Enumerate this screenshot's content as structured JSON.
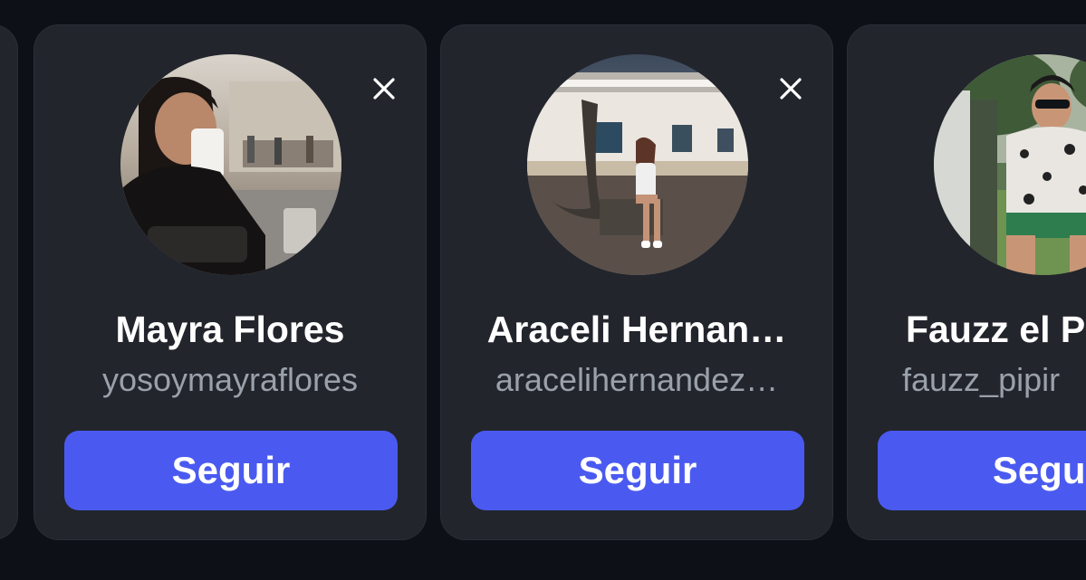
{
  "suggestions": [
    {
      "name": "Mayra Flores",
      "username": "yosoymayraflores",
      "follow_label": "Seguir",
      "avatar_icon": "profile-photo"
    },
    {
      "name": "Araceli Hernan…",
      "username": "aracelihernandez…",
      "follow_label": "Seguir",
      "avatar_icon": "profile-photo"
    },
    {
      "name": "Fauzz el P",
      "username": "fauzz_pipir",
      "follow_label": "Segui",
      "avatar_icon": "profile-photo"
    }
  ],
  "icons": {
    "close": "close-icon"
  },
  "colors": {
    "background": "#0d1117",
    "card": "#22252c",
    "button": "#4a5af0",
    "username": "#9ba1aa"
  }
}
